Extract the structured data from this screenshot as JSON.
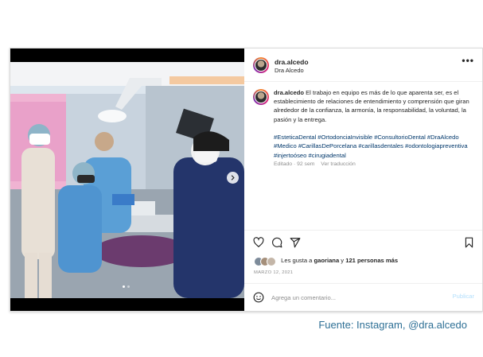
{
  "profile": {
    "username": "dra.alcedo",
    "display_name": "Dra Alcedo"
  },
  "caption": {
    "username": "dra.alcedo",
    "text": "El trabajo en equipo es más de lo que aparenta ser, es el establecimiento de relaciones de entendimiento y comprensión que giran alrededor de la confianza, la armonía, la responsabilidad, la voluntad, la pasión y la entrega.",
    "hashtags": "#EsteticaDental #OrtodonciaInvisible #ConsultorioDental #DraAlcedo #Medico #CarillasDePorcelana #carillasdentales #odontologiapreventiva #injertoóseo #cirugiadental",
    "time_ago": "Editado · 92 sem",
    "translate": "Ver traducción"
  },
  "likes": {
    "prefix": "Les gusta a",
    "user": "gaoriana",
    "connector": "y",
    "count": "121 personas más"
  },
  "date": "MARZO 12, 2021",
  "comment": {
    "placeholder": "Agrega un comentario...",
    "publish_label": "Publicar"
  },
  "more_label": "•••",
  "source_text": "Fuente: Instagram, @dra.alcedo",
  "carousel": {
    "current_slide": 1,
    "total_slides": 2
  },
  "icons": [
    "heart-icon",
    "comment-icon",
    "share-icon",
    "bookmark-icon",
    "emoji-icon",
    "next-arrow-icon"
  ],
  "colors": {
    "link": "#00376b",
    "muted": "#8e8e8e",
    "publish": "#b2dffc",
    "source": "#2d6f95"
  }
}
